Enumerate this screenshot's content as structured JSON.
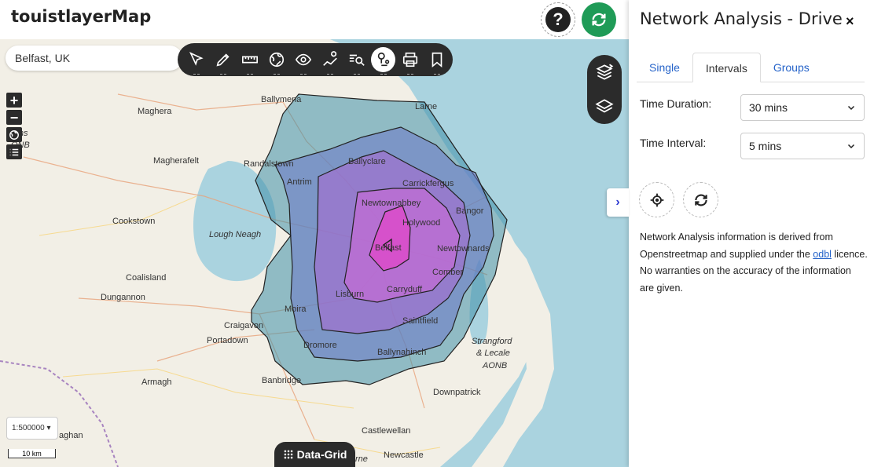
{
  "app": {
    "title": "touistlayerMap"
  },
  "header": {
    "help_symbol": "?"
  },
  "search": {
    "value": "Belfast, UK"
  },
  "map": {
    "labels": {
      "ballymena": "Ballymena",
      "magherafelt": "Magherafelt",
      "maghera": "Maghera",
      "larne": "Larne",
      "randalstown": "Randalstown",
      "antrim": "Antrim",
      "ballyclare": "Ballyclare",
      "carrickfergus": "Carrickfergus",
      "newtownabbey": "Newtownabbey",
      "bangor": "Bangor",
      "holywood": "Holywood",
      "belfast": "Belfast",
      "newtownards": "Newtownards",
      "comber": "Comber",
      "cookstown": "Cookstown",
      "lough_neagh": "Lough Neagh",
      "coalisland": "Coalisland",
      "dungannon": "Dungannon",
      "lisburn": "Lisburn",
      "carryduff": "Carryduff",
      "moira": "Moira",
      "saintfield": "Saintfield",
      "craigavon": "Craigavon",
      "portadown": "Portadown",
      "dromore": "Dromore",
      "ballynahinch": "Ballynahinch",
      "strangford1": "Strangford",
      "strangford2": "& Lecale",
      "strangford3": "AONB",
      "armagh": "Armagh",
      "banbridge": "Banbridge",
      "downpatrick": "Downpatrick",
      "castlewellan": "Castlewellan",
      "newcastle": "Newcastle",
      "aghan": "aghan",
      "rne": "rne",
      "sperrins1": "errins",
      "sperrins2": "ONB"
    },
    "colors": {
      "water": "#aad3df",
      "land": "#f2efe6",
      "outer_iso": "#3f8fa8",
      "mid_iso": "#7a7fd0",
      "inner_iso": "#c86ad6",
      "core_iso": "#e445c8"
    }
  },
  "zoom": {
    "in": "+",
    "out": "−"
  },
  "scale": {
    "ratio": "1:500000",
    "bar": "10 km"
  },
  "datagrid": {
    "label": "Data-Grid"
  },
  "panel": {
    "title": "Network Analysis - Drive",
    "close": "×",
    "tabs": {
      "single": "Single",
      "intervals": "Intervals",
      "groups": "Groups"
    },
    "duration_label": "Time Duration:",
    "duration_value": "30 mins",
    "interval_label": "Time Interval:",
    "interval_value": "5 mins",
    "info_pre": "Network Analysis information is derived from Openstreetmap and supplied under the ",
    "info_link": "odbl",
    "info_post": " licence. No warranties on the accuracy of the information are given."
  }
}
